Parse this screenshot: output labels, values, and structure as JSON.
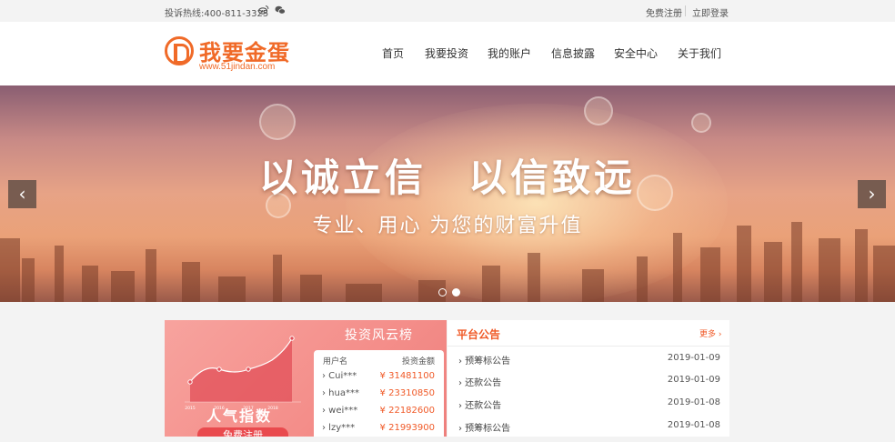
{
  "topbar": {
    "hotline": "投诉热线:400-811-3325",
    "register": "免费注册",
    "login": "立即登录"
  },
  "header": {
    "logo_name": "我要金蛋",
    "logo_url": "www.51jindan.com",
    "nav": [
      "首页",
      "我要投资",
      "我的账户",
      "信息披露",
      "安全中心",
      "关于我们"
    ]
  },
  "banner": {
    "headline": "以诚立信　以信致远",
    "subtitle": "专业、用心 为您的财富升值",
    "prev": "‹",
    "next": "›"
  },
  "popular": {
    "title": "人气指数",
    "years": [
      "2015",
      "2016",
      "2017",
      "2018"
    ],
    "cta": "免费注册"
  },
  "ranking": {
    "title": "投资风云榜",
    "col_user": "用户名",
    "col_amount": "投资金额",
    "rows": [
      {
        "user": "› Cui***",
        "amount": "¥ 31481100"
      },
      {
        "user": "› hua***",
        "amount": "¥ 23310850"
      },
      {
        "user": "› wei***",
        "amount": "¥ 22182600"
      },
      {
        "user": "› lzy***",
        "amount": "¥ 21993900"
      }
    ]
  },
  "notices": {
    "title": "平台公告",
    "more": "更多 ›",
    "rows": [
      {
        "title": "› 预筹标公告",
        "date": "2019-01-09"
      },
      {
        "title": "› 还款公告",
        "date": "2019-01-09"
      },
      {
        "title": "› 还款公告",
        "date": "2019-01-08"
      },
      {
        "title": "› 预筹标公告",
        "date": "2019-01-08"
      }
    ]
  },
  "colors": {
    "brand": "#f06a28",
    "accent": "#f05a28"
  }
}
